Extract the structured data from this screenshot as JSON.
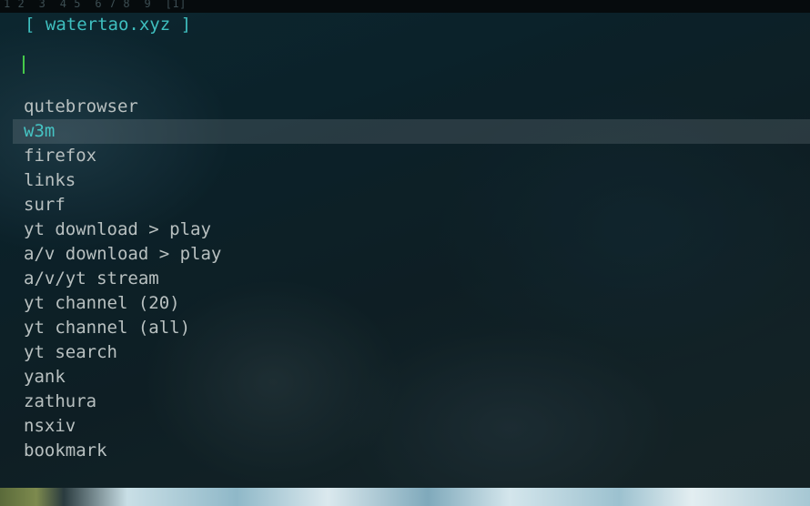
{
  "topbar": {
    "workspaces": "1 2  3  4 5  6 7 8  9  [1]"
  },
  "prompt": {
    "title": "[ watertao.xyz ]",
    "input_value": ""
  },
  "menu": {
    "selected_index": 1,
    "items": [
      "qutebrowser",
      "w3m",
      "firefox",
      "links",
      "surf",
      "yt download > play",
      "a/v download > play",
      "a/v/yt stream",
      "yt channel (20)",
      "yt channel (all)",
      "yt search",
      "yank",
      "zathura",
      "nsxiv",
      "bookmark"
    ]
  },
  "colors": {
    "accent": "#3fbfbf",
    "cursor": "#45c94a",
    "item_text": "#b8c0c0",
    "selection_bg": "#2f3c40"
  }
}
